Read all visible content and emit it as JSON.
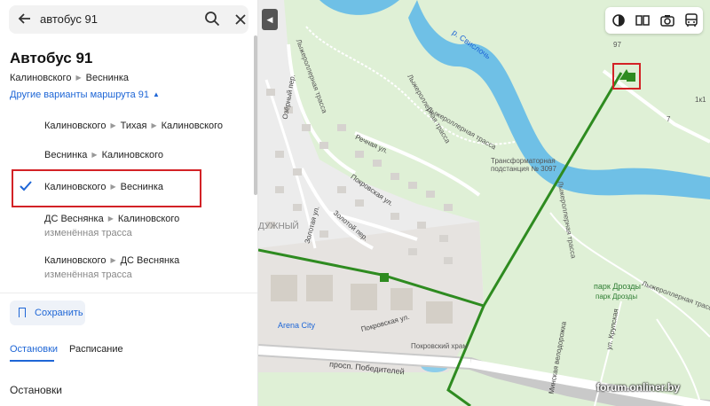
{
  "search": {
    "query": "автобус 91"
  },
  "route": {
    "title": "Автобус 91",
    "from": "Калиновского",
    "to": "Веснинка",
    "other_variants": "Другие варианты маршрута 91"
  },
  "variants": [
    {
      "stops": [
        "Калиновского",
        "Тихая",
        "Калиновского"
      ],
      "note": ""
    },
    {
      "stops": [
        "Веснинка",
        "Калиновского"
      ],
      "note": ""
    },
    {
      "stops": [
        "Калиновского",
        "Веснинка"
      ],
      "note": "",
      "selected": true
    },
    {
      "stops": [
        "ДС Веснянка",
        "Калиновского"
      ],
      "note": "изменённая трасса"
    },
    {
      "stops": [
        "Калиновского",
        "ДС Веснянка"
      ],
      "note": "изменённая трасса"
    }
  ],
  "actions": {
    "save": "Сохранить"
  },
  "tabs": [
    "Остановки",
    "Расписание"
  ],
  "stops_header": "Остановки",
  "map": {
    "labels": {
      "river": "р. Свислочь",
      "trail1": "Лыжероллерная трасса",
      "trail2": "Лыжероллерная трасса",
      "trail3": "Лыжероллерная трасса",
      "trail4": "Лыжероллерная трасса",
      "trail5": "Лыжероллерная трасса",
      "substation1": "Трансформаторная",
      "substation2": "подстанция № 3097",
      "park1": "парк Дрозды",
      "park2": "парк Дрозды",
      "ozerny": "Озёрный пер.",
      "rechnaya": "Речная ул.",
      "pokrovskaya": "Покровская ул.",
      "zolotoy": "Золотой пер.",
      "zolotaya": "Золотая ул.",
      "raduzhny": "ДУЖНЫЙ",
      "arena": "Arena City",
      "pokrovskaya2": "Покровская ул.",
      "temple": "Покровский храм",
      "prospekt": "просп. Победителей",
      "velodrom": "Минская велодорожка",
      "krupskaya": "ул. Крупская",
      "num97": "97",
      "num7": "7",
      "num1k1": "1к1"
    },
    "watermark": "forum.onliner.by",
    "route_color": "#2e8b20"
  }
}
